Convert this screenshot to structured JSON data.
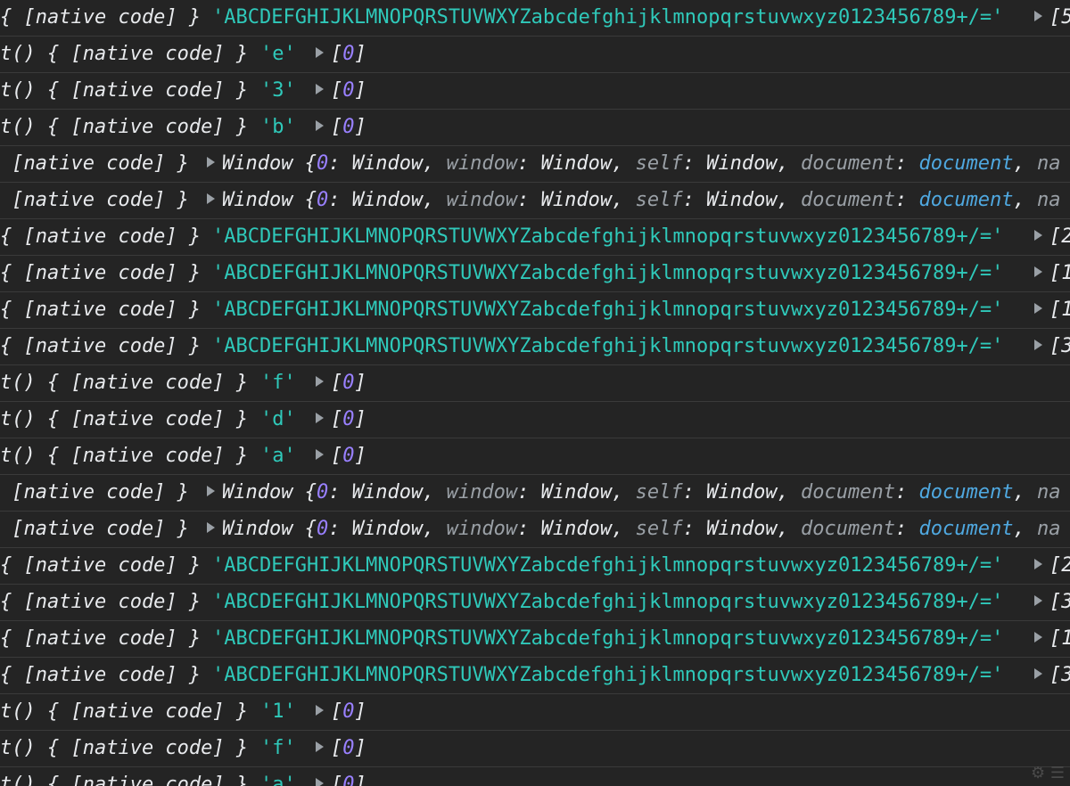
{
  "console": {
    "rows": [
      {
        "kind": "str",
        "prefix": "{ [native code] } ",
        "value": "'ABCDEFGHIJKLMNOPQRSTUVWXYZabcdefghijklmnopqrstuvwxyz0123456789+/='",
        "tail": "[5"
      },
      {
        "kind": "char",
        "prefix": "t() { [native code] } ",
        "value": "'e'",
        "tail": "[0]"
      },
      {
        "kind": "char",
        "prefix": "t() { [native code] } ",
        "value": "'3'",
        "tail": "[0]"
      },
      {
        "kind": "char",
        "prefix": "t() { [native code] } ",
        "value": "'b'",
        "tail": "[0]"
      },
      {
        "kind": "win",
        "prefix": " [native code] } ",
        "value": "Window {0: Window, window: Window, self: Window, document: document, na"
      },
      {
        "kind": "win",
        "prefix": " [native code] } ",
        "value": "Window {0: Window, window: Window, self: Window, document: document, na"
      },
      {
        "kind": "str",
        "prefix": "{ [native code] } ",
        "value": "'ABCDEFGHIJKLMNOPQRSTUVWXYZabcdefghijklmnopqrstuvwxyz0123456789+/='",
        "tail": "[2"
      },
      {
        "kind": "str",
        "prefix": "{ [native code] } ",
        "value": "'ABCDEFGHIJKLMNOPQRSTUVWXYZabcdefghijklmnopqrstuvwxyz0123456789+/='",
        "tail": "[1"
      },
      {
        "kind": "str",
        "prefix": "{ [native code] } ",
        "value": "'ABCDEFGHIJKLMNOPQRSTUVWXYZabcdefghijklmnopqrstuvwxyz0123456789+/='",
        "tail": "[1"
      },
      {
        "kind": "str",
        "prefix": "{ [native code] } ",
        "value": "'ABCDEFGHIJKLMNOPQRSTUVWXYZabcdefghijklmnopqrstuvwxyz0123456789+/='",
        "tail": "[3"
      },
      {
        "kind": "char",
        "prefix": "t() { [native code] } ",
        "value": "'f'",
        "tail": "[0]"
      },
      {
        "kind": "char",
        "prefix": "t() { [native code] } ",
        "value": "'d'",
        "tail": "[0]"
      },
      {
        "kind": "char",
        "prefix": "t() { [native code] } ",
        "value": "'a'",
        "tail": "[0]"
      },
      {
        "kind": "win",
        "prefix": " [native code] } ",
        "value": "Window {0: Window, window: Window, self: Window, document: document, na"
      },
      {
        "kind": "win",
        "prefix": " [native code] } ",
        "value": "Window {0: Window, window: Window, self: Window, document: document, na"
      },
      {
        "kind": "str",
        "prefix": "{ [native code] } ",
        "value": "'ABCDEFGHIJKLMNOPQRSTUVWXYZabcdefghijklmnopqrstuvwxyz0123456789+/='",
        "tail": "[2"
      },
      {
        "kind": "str",
        "prefix": "{ [native code] } ",
        "value": "'ABCDEFGHIJKLMNOPQRSTUVWXYZabcdefghijklmnopqrstuvwxyz0123456789+/='",
        "tail": "[3"
      },
      {
        "kind": "str",
        "prefix": "{ [native code] } ",
        "value": "'ABCDEFGHIJKLMNOPQRSTUVWXYZabcdefghijklmnopqrstuvwxyz0123456789+/='",
        "tail": "[1"
      },
      {
        "kind": "str",
        "prefix": "{ [native code] } ",
        "value": "'ABCDEFGHIJKLMNOPQRSTUVWXYZabcdefghijklmnopqrstuvwxyz0123456789+/='",
        "tail": "[3"
      },
      {
        "kind": "char",
        "prefix": "t() { [native code] } ",
        "value": "'1'",
        "tail": "[0]"
      },
      {
        "kind": "char",
        "prefix": "t() { [native code] } ",
        "value": "'f'",
        "tail": "[0]"
      },
      {
        "kind": "char",
        "prefix": "t() { [native code] } ",
        "value": "'a'",
        "tail": "[0]"
      }
    ]
  },
  "colors": {
    "background": "#242424",
    "string": "#2fc9ba",
    "number": "#9980ff",
    "link": "#4fa8e0",
    "muted": "#9aa0a6"
  },
  "icons": {
    "expand": "expand-triangle-icon"
  }
}
